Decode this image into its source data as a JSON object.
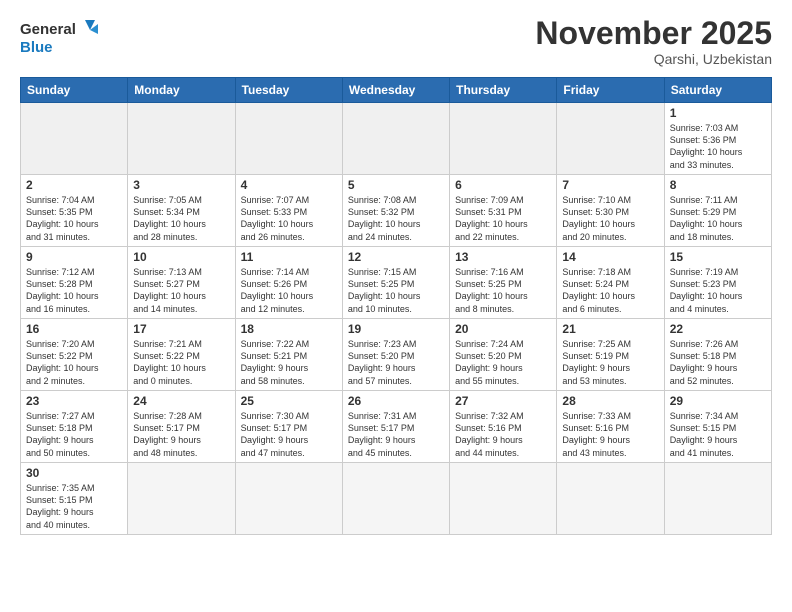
{
  "logo": {
    "line1": "General",
    "line2": "Blue"
  },
  "header": {
    "month": "November 2025",
    "location": "Qarshi, Uzbekistan"
  },
  "weekdays": [
    "Sunday",
    "Monday",
    "Tuesday",
    "Wednesday",
    "Thursday",
    "Friday",
    "Saturday"
  ],
  "days": {
    "d1": {
      "num": "1",
      "info": "Sunrise: 7:03 AM\nSunset: 5:36 PM\nDaylight: 10 hours\nand 33 minutes."
    },
    "d2": {
      "num": "2",
      "info": "Sunrise: 7:04 AM\nSunset: 5:35 PM\nDaylight: 10 hours\nand 31 minutes."
    },
    "d3": {
      "num": "3",
      "info": "Sunrise: 7:05 AM\nSunset: 5:34 PM\nDaylight: 10 hours\nand 28 minutes."
    },
    "d4": {
      "num": "4",
      "info": "Sunrise: 7:07 AM\nSunset: 5:33 PM\nDaylight: 10 hours\nand 26 minutes."
    },
    "d5": {
      "num": "5",
      "info": "Sunrise: 7:08 AM\nSunset: 5:32 PM\nDaylight: 10 hours\nand 24 minutes."
    },
    "d6": {
      "num": "6",
      "info": "Sunrise: 7:09 AM\nSunset: 5:31 PM\nDaylight: 10 hours\nand 22 minutes."
    },
    "d7": {
      "num": "7",
      "info": "Sunrise: 7:10 AM\nSunset: 5:30 PM\nDaylight: 10 hours\nand 20 minutes."
    },
    "d8": {
      "num": "8",
      "info": "Sunrise: 7:11 AM\nSunset: 5:29 PM\nDaylight: 10 hours\nand 18 minutes."
    },
    "d9": {
      "num": "9",
      "info": "Sunrise: 7:12 AM\nSunset: 5:28 PM\nDaylight: 10 hours\nand 16 minutes."
    },
    "d10": {
      "num": "10",
      "info": "Sunrise: 7:13 AM\nSunset: 5:27 PM\nDaylight: 10 hours\nand 14 minutes."
    },
    "d11": {
      "num": "11",
      "info": "Sunrise: 7:14 AM\nSunset: 5:26 PM\nDaylight: 10 hours\nand 12 minutes."
    },
    "d12": {
      "num": "12",
      "info": "Sunrise: 7:15 AM\nSunset: 5:25 PM\nDaylight: 10 hours\nand 10 minutes."
    },
    "d13": {
      "num": "13",
      "info": "Sunrise: 7:16 AM\nSunset: 5:25 PM\nDaylight: 10 hours\nand 8 minutes."
    },
    "d14": {
      "num": "14",
      "info": "Sunrise: 7:18 AM\nSunset: 5:24 PM\nDaylight: 10 hours\nand 6 minutes."
    },
    "d15": {
      "num": "15",
      "info": "Sunrise: 7:19 AM\nSunset: 5:23 PM\nDaylight: 10 hours\nand 4 minutes."
    },
    "d16": {
      "num": "16",
      "info": "Sunrise: 7:20 AM\nSunset: 5:22 PM\nDaylight: 10 hours\nand 2 minutes."
    },
    "d17": {
      "num": "17",
      "info": "Sunrise: 7:21 AM\nSunset: 5:22 PM\nDaylight: 10 hours\nand 0 minutes."
    },
    "d18": {
      "num": "18",
      "info": "Sunrise: 7:22 AM\nSunset: 5:21 PM\nDaylight: 9 hours\nand 58 minutes."
    },
    "d19": {
      "num": "19",
      "info": "Sunrise: 7:23 AM\nSunset: 5:20 PM\nDaylight: 9 hours\nand 57 minutes."
    },
    "d20": {
      "num": "20",
      "info": "Sunrise: 7:24 AM\nSunset: 5:20 PM\nDaylight: 9 hours\nand 55 minutes."
    },
    "d21": {
      "num": "21",
      "info": "Sunrise: 7:25 AM\nSunset: 5:19 PM\nDaylight: 9 hours\nand 53 minutes."
    },
    "d22": {
      "num": "22",
      "info": "Sunrise: 7:26 AM\nSunset: 5:18 PM\nDaylight: 9 hours\nand 52 minutes."
    },
    "d23": {
      "num": "23",
      "info": "Sunrise: 7:27 AM\nSunset: 5:18 PM\nDaylight: 9 hours\nand 50 minutes."
    },
    "d24": {
      "num": "24",
      "info": "Sunrise: 7:28 AM\nSunset: 5:17 PM\nDaylight: 9 hours\nand 48 minutes."
    },
    "d25": {
      "num": "25",
      "info": "Sunrise: 7:30 AM\nSunset: 5:17 PM\nDaylight: 9 hours\nand 47 minutes."
    },
    "d26": {
      "num": "26",
      "info": "Sunrise: 7:31 AM\nSunset: 5:17 PM\nDaylight: 9 hours\nand 45 minutes."
    },
    "d27": {
      "num": "27",
      "info": "Sunrise: 7:32 AM\nSunset: 5:16 PM\nDaylight: 9 hours\nand 44 minutes."
    },
    "d28": {
      "num": "28",
      "info": "Sunrise: 7:33 AM\nSunset: 5:16 PM\nDaylight: 9 hours\nand 43 minutes."
    },
    "d29": {
      "num": "29",
      "info": "Sunrise: 7:34 AM\nSunset: 5:15 PM\nDaylight: 9 hours\nand 41 minutes."
    },
    "d30": {
      "num": "30",
      "info": "Sunrise: 7:35 AM\nSunset: 5:15 PM\nDaylight: 9 hours\nand 40 minutes."
    }
  }
}
